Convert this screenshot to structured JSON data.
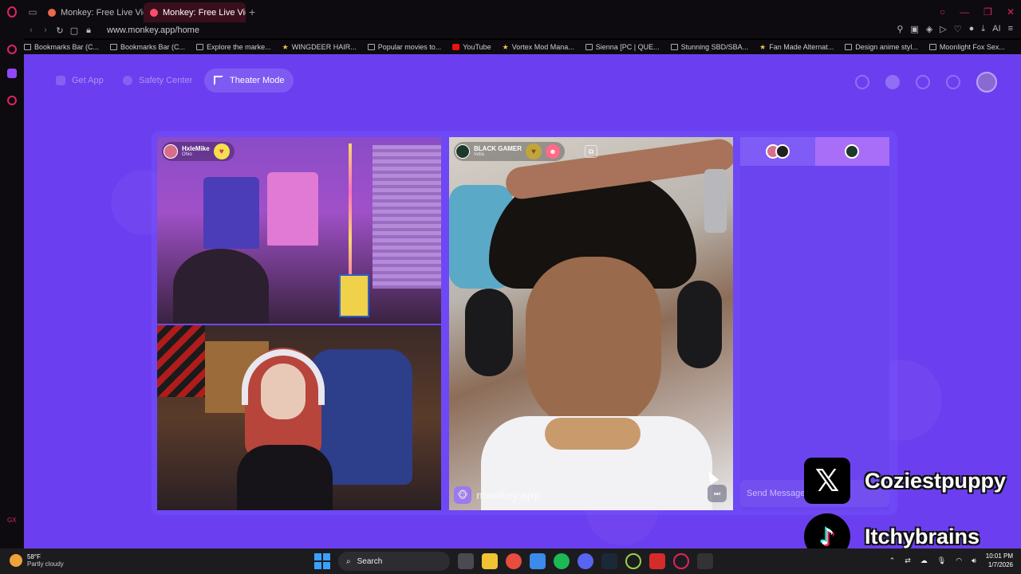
{
  "browser": {
    "tabs": [
      {
        "label": "Monkey: Free Live Video C",
        "active": false
      },
      {
        "label": "Monkey: Free Live Vid",
        "active": true
      }
    ],
    "url": "www.monkey.app/home",
    "right_ai_label": "AI",
    "bookmarks": [
      {
        "label": "Bookmarks Bar (C...",
        "icon": "folder-icon"
      },
      {
        "label": "Bookmarks Bar (C...",
        "icon": "folder-icon"
      },
      {
        "label": "Explore the marke...",
        "icon": "page-icon"
      },
      {
        "label": "WINGDEER HAIR...",
        "icon": "star-icon"
      },
      {
        "label": "Popular movies to...",
        "icon": "page-icon"
      },
      {
        "label": "YouTube",
        "icon": "youtube-icon"
      },
      {
        "label": "Vortex Mod Mana...",
        "icon": "star-icon"
      },
      {
        "label": "Sienna [PC | QUE...",
        "icon": "page-icon"
      },
      {
        "label": "Stunning SBD/SBA...",
        "icon": "page-icon"
      },
      {
        "label": "Fan Made Alternat...",
        "icon": "star-icon"
      },
      {
        "label": "Design anime styl...",
        "icon": "page-icon"
      },
      {
        "label": "Moonlight Fox Sex...",
        "icon": "page-icon"
      }
    ]
  },
  "app": {
    "nav": {
      "get_app": "Get App",
      "safety_center": "Safety Center",
      "theater_mode": "Theater Mode"
    },
    "video_top_left": {
      "username": "HxleMike",
      "location": "Ohio"
    },
    "video_right": {
      "username": "BLACK GAMER",
      "location": "India"
    },
    "watermark": "monkey.app",
    "chat": {
      "placeholder": "Send Message"
    },
    "colors": {
      "page_bg": "#6b3ff0",
      "heart": "#f5e04a"
    }
  },
  "overlay": {
    "x_handle": "Coziestpuppy",
    "tiktok_handle": "Itchybrains"
  },
  "taskbar": {
    "weather_temp": "58°F",
    "weather_desc": "Partly cloudy",
    "search_label": "Search",
    "time": "10:01 PM",
    "date": "1/7/2026"
  }
}
